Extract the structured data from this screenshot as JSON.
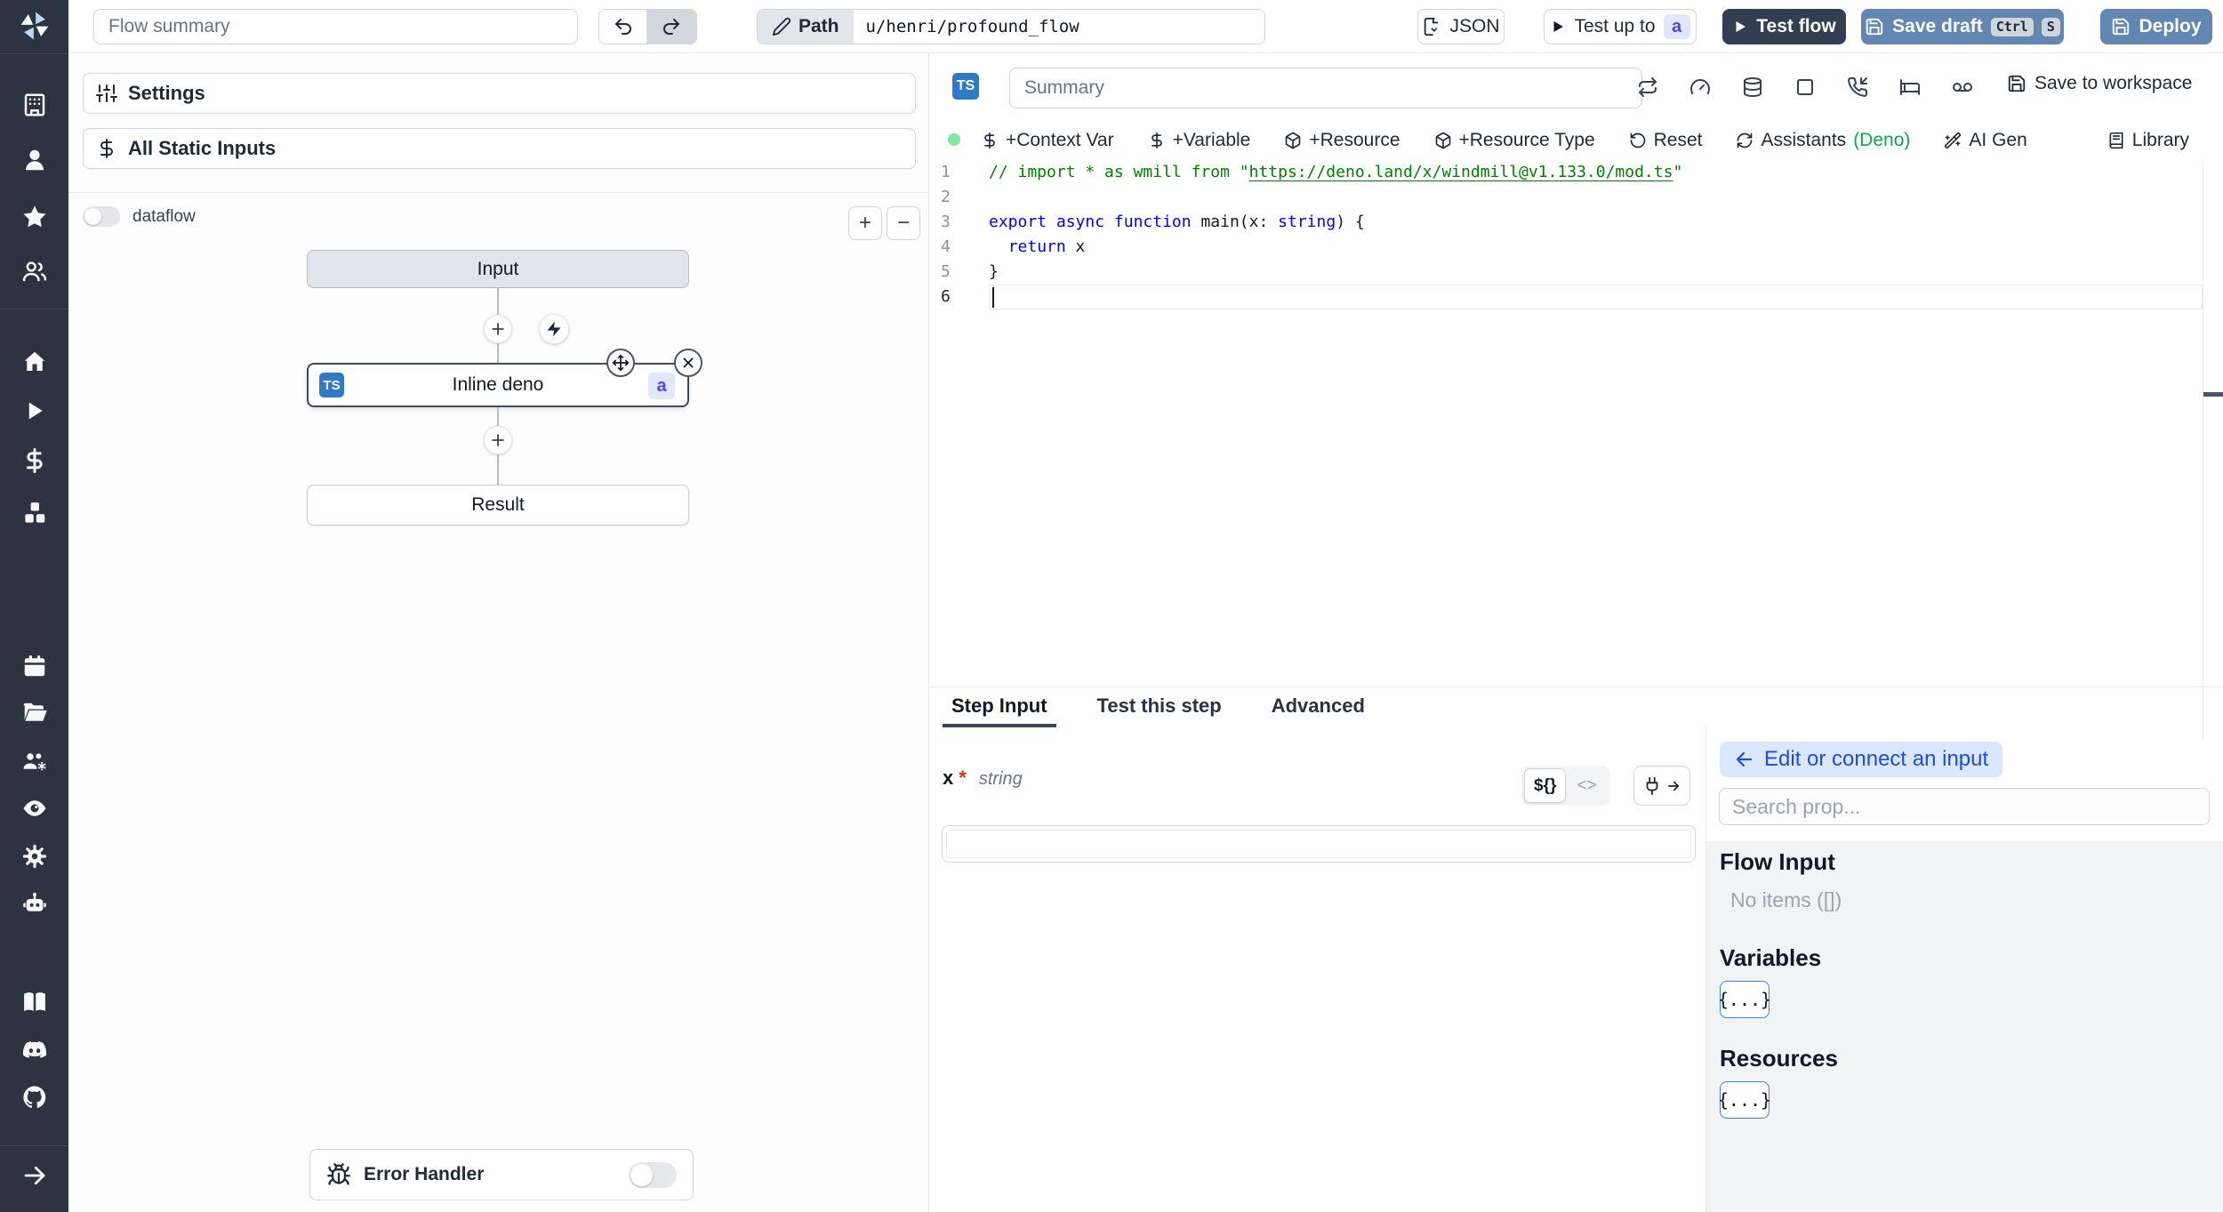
{
  "colors": {
    "sidebar_bg": "#2b3440",
    "primary_button_bg": "#6287b2",
    "dark_button_bg": "#333e52",
    "ts_badge_bg": "#3178c6",
    "step_badge_bg": "#e0e7ff",
    "step_badge_text": "#4f46e5",
    "lang_ok_dot": "#81e6a3",
    "deno_green": "#16a34a",
    "connect_button_bg": "#dbe7fd",
    "connect_button_text": "#1d4ed8"
  },
  "topbar": {
    "flow_summary_placeholder": "Flow summary",
    "path_label": "Path",
    "path_value": "u/henri/profound_flow",
    "json_label": "JSON",
    "test_up_to_label": "Test up to",
    "test_up_to_badge": "a",
    "test_flow_label": "Test flow",
    "save_draft_label": "Save draft",
    "kbd_ctrl": "Ctrl",
    "kbd_s": "S",
    "deploy_label": "Deploy"
  },
  "flow_panel": {
    "settings_label": "Settings",
    "static_inputs_label": "All Static Inputs",
    "dataflow_label": "dataflow",
    "zoom_in": "+",
    "zoom_out": "−",
    "input_node": "Input",
    "step_node": "Inline deno",
    "step_lang_badge": "TS",
    "step_suffix_badge": "a",
    "result_node": "Result",
    "error_handler_label": "Error Handler"
  },
  "editor": {
    "lang_badge": "TS",
    "summary_placeholder": "Summary",
    "save_to_workspace": "Save to workspace",
    "toolbar": {
      "context_var": "+Context Var",
      "variable": "+Variable",
      "resource": "+Resource",
      "resource_type": "+Resource Type",
      "reset": "Reset",
      "assistants": "Assistants",
      "assistants_lang": "(Deno)",
      "ai_gen": "AI Gen",
      "library": "Library"
    },
    "code": {
      "lines": [
        {
          "n": "1",
          "tokens": [
            {
              "c": "cm",
              "t": "// import * as wmill from \""
            },
            {
              "c": "cm link",
              "t": "https://deno.land/x/windmill@v1.133.0/mod.ts"
            },
            {
              "c": "cm",
              "t": "\""
            }
          ]
        },
        {
          "n": "2",
          "tokens": []
        },
        {
          "n": "3",
          "tokens": [
            {
              "c": "kw",
              "t": "export"
            },
            {
              "c": "pl",
              "t": " "
            },
            {
              "c": "kw",
              "t": "async"
            },
            {
              "c": "pl",
              "t": " "
            },
            {
              "c": "kw",
              "t": "function"
            },
            {
              "c": "pl",
              "t": " main(x: "
            },
            {
              "c": "kw",
              "t": "string"
            },
            {
              "c": "pl",
              "t": ") {"
            }
          ]
        },
        {
          "n": "4",
          "tokens": [
            {
              "c": "pl",
              "t": "  "
            },
            {
              "c": "kw",
              "t": "return"
            },
            {
              "c": "pl",
              "t": " x"
            }
          ]
        },
        {
          "n": "5",
          "tokens": [
            {
              "c": "pl",
              "t": "}"
            }
          ]
        },
        {
          "n": "6",
          "tokens": [],
          "cursor": true,
          "active": true
        }
      ]
    }
  },
  "bottom": {
    "tabs": [
      "Step Input",
      "Test this step",
      "Advanced"
    ],
    "field_name": "x",
    "required_mark": "*",
    "field_type": "string",
    "expr_toggle": "${}",
    "code_toggle": "<>"
  },
  "connect_panel": {
    "edit_button": "Edit or connect an input",
    "search_placeholder": "Search prop...",
    "flow_input_title": "Flow Input",
    "flow_input_empty": "No items ([])",
    "variables_title": "Variables",
    "resources_title": "Resources",
    "object_chip": "{...}"
  }
}
